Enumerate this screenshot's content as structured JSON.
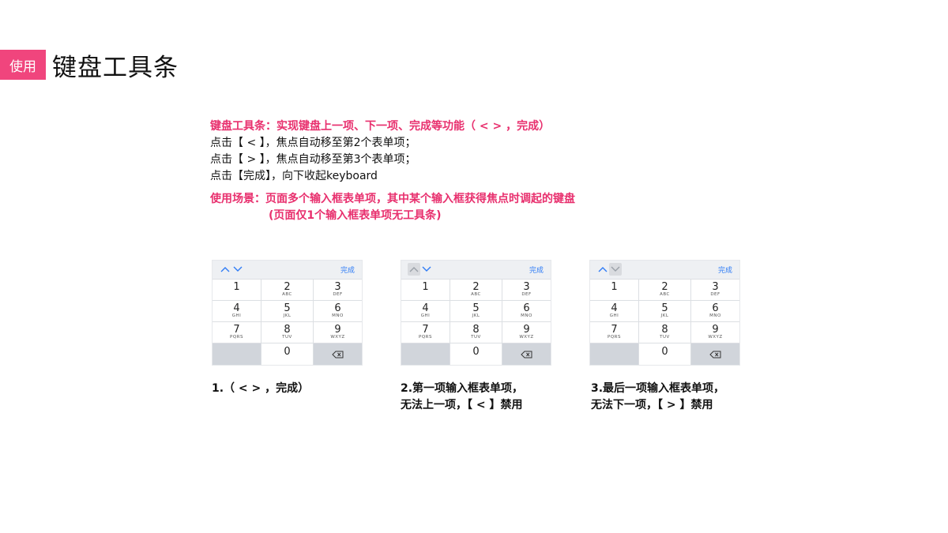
{
  "header": {
    "tag": "使用",
    "title": "键盘工具条"
  },
  "description": {
    "heading": "键盘工具条：实现键盘上一项、下一项、完成等功能（ < > ，完成）",
    "lines": [
      "点击【 < 】，焦点自动移至第2个表单项；",
      "点击【 > 】，焦点自动移至第3个表单项；",
      "点击【完成】，向下收起keyboard"
    ],
    "scenario_line1": "使用场景：页面多个输入框表单项，其中某个输入框获得焦点时调起的键盘",
    "scenario_line2": "(页面仅1个输入框表单项无工具条)"
  },
  "keyboard": {
    "done_label": "完成",
    "keys": [
      {
        "num": "1",
        "sub": ""
      },
      {
        "num": "2",
        "sub": "ABC"
      },
      {
        "num": "3",
        "sub": "DEF"
      },
      {
        "num": "4",
        "sub": "GHI"
      },
      {
        "num": "5",
        "sub": "JKL"
      },
      {
        "num": "6",
        "sub": "MNO"
      },
      {
        "num": "7",
        "sub": "PQRS"
      },
      {
        "num": "8",
        "sub": "TUV"
      },
      {
        "num": "9",
        "sub": "WXYZ"
      },
      {
        "num": "",
        "sub": ""
      },
      {
        "num": "0",
        "sub": ""
      },
      {
        "num": "",
        "sub": ""
      }
    ]
  },
  "examples": [
    {
      "caption_line1": "1.（ < > ，完成）",
      "caption_line2": "",
      "disabled": "none"
    },
    {
      "caption_line1": "2.第一项输入框表单项，",
      "caption_line2": "无法上一项，【 < 】禁用",
      "disabled": "up"
    },
    {
      "caption_line1": "3.最后一项输入框表单项，",
      "caption_line2": "无法下一项，【 > 】禁用",
      "disabled": "down"
    }
  ],
  "colors": {
    "accent": "#f0457d",
    "link": "#2f7cf6",
    "key_gray": "#d1d5db"
  },
  "icons": {
    "up": "chevron-up-icon",
    "down": "chevron-down-icon",
    "delete": "backspace-icon"
  }
}
